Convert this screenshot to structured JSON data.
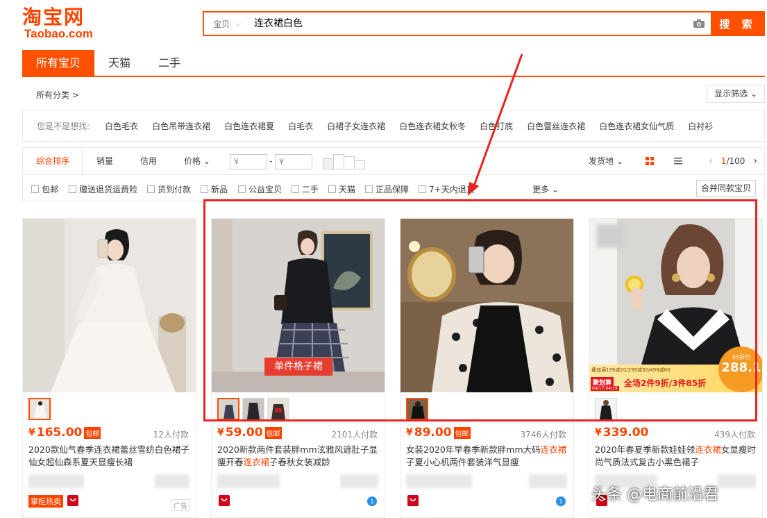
{
  "logo": {
    "cn": "淘宝网",
    "en": "Taobao.com"
  },
  "search": {
    "category": "宝贝",
    "query": "连衣裙白色",
    "button": "搜 索"
  },
  "tabs": [
    {
      "label": "所有宝贝",
      "active": true
    },
    {
      "label": "天猫",
      "active": false
    },
    {
      "label": "二手",
      "active": false
    }
  ],
  "category_row": {
    "all": "所有分类 >",
    "filter_button": "显示筛选 ⌄"
  },
  "suggest": {
    "label": "您是不是想找:",
    "items": [
      "白色毛衣",
      "白色吊带连衣裙",
      "白色连衣裙夏",
      "白毛衣",
      "白裙子女连衣裙",
      "白色连衣裙女秋冬",
      "白色打底",
      "白色蕾丝连衣裙",
      "白色连衣裙女仙气质",
      "白衬衫"
    ]
  },
  "sortbar": {
    "items": [
      "综合排序",
      "销量",
      "信用",
      "价格 ⌄"
    ],
    "price_from": "¥",
    "price_to": "¥",
    "dash": "-",
    "ship_from": "发货地 ⌄",
    "page": "1",
    "page_total": "/100"
  },
  "checks": {
    "items": [
      "包邮",
      "赠送退货运费险",
      "货到付款",
      "新品",
      "公益宝贝",
      "二手",
      "天猫",
      "正品保障",
      "7+天内退货"
    ],
    "more": "更多 ⌄",
    "merge": "合并同款宝贝"
  },
  "products": [
    {
      "price": "165.00",
      "free": "包邮",
      "deals": "12人付款",
      "title_parts": [
        "2020款仙气春季连衣裙蕾丝雪纺白色裙子仙女超仙森系夏天显瘦长裙"
      ],
      "shop_tag": "掌柜热卖",
      "ad": "广告"
    },
    {
      "price": "59.00",
      "free": "包邮",
      "deals": "2101人付款",
      "banner": "单件格子裙",
      "title_parts": [
        "2020新款两件套装胖mm泫雅风遮肚子显瘦开春",
        "连衣裙",
        "子春秋女装减龄"
      ]
    },
    {
      "price": "89.00",
      "free": "包邮",
      "deals": "3746人付款",
      "title_parts": [
        "女装2020年早春季新款胖mm大码",
        "连衣裙",
        "子夏小心机两件套装洋气显瘦"
      ]
    },
    {
      "price": "339.00",
      "deals": "439人付款",
      "title_parts": [
        "2020年春夏季新款娃娃领",
        "连衣裙",
        "女显瘦时尚气质法式复古小黑色裙子"
      ],
      "promo": {
        "line1": "叠加满199减20/299减30/499减60",
        "line2": "全场2件9折/3件85折",
        "left": "聚划算",
        "date": "04/17-04/19",
        "badge_small": "85折价",
        "badge_price": "288.1"
      }
    }
  ],
  "watermark": "头条 @电商前沿君",
  "colors": {
    "brand": "#ff5000",
    "price": "#ff4400",
    "annotation": "#e8231f"
  }
}
